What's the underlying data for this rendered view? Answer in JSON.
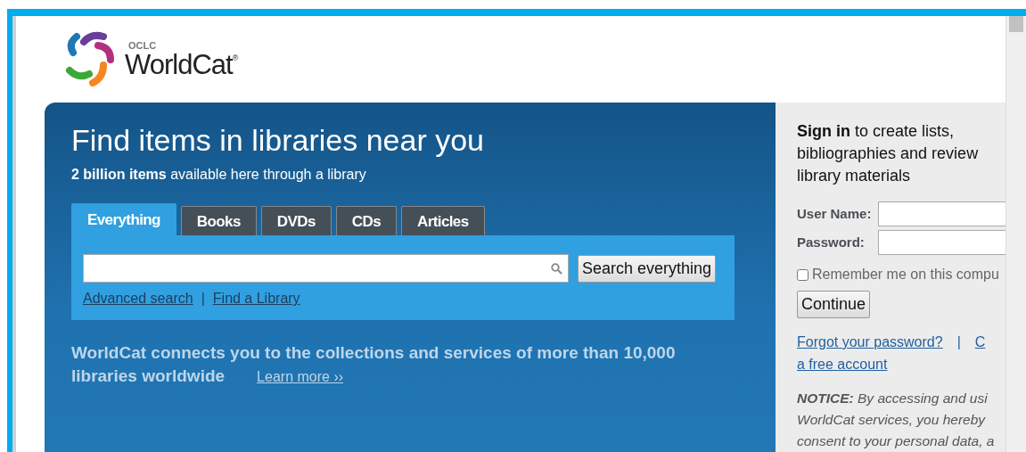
{
  "logo": {
    "overline": "OCLC",
    "name": "WorldCat$^{®}$"
  },
  "hero": {
    "title": "Find items in libraries near you",
    "subtitle": "**2 billion items** available here through a library"
  },
  "tabs": [
    {
      "label": "Everything",
      "selected": true
    },
    {
      "label": "Books",
      "selected": false
    },
    {
      "label": "DVDs",
      "selected": false
    },
    {
      "label": "CDs",
      "selected": false
    },
    {
      "label": "Articles",
      "selected": false
    }
  ],
  "search": {
    "button": "Search everything",
    "links": [
      "Advanced search",
      "Find a Library"
    ],
    "separator": "|"
  },
  "about": {
    "lines": [
      "WorldCat connects you to the collections and services of more than 10,000",
      "libraries worldwide"
    ],
    "link": "Learn more ››"
  },
  "sign_in": {
    "intro_lines": [
      "**Sign in** to create lists,",
      "bibliographies and review",
      "library materials"
    ],
    "fields": [
      {
        "label": "User Name:"
      },
      {
        "label": "Password:"
      }
    ],
    "remember": {
      "label": "Remember me on this compu",
      "checked": false
    },
    "button": "Continue",
    "forgot_link": "Forgot your password?",
    "separator": "|",
    "create_link_parts": [
      "C",
      "a free account"
    ],
    "notice_lines": [
      "**NOTICE:** By accessing and usi",
      "WorldCat services, you hereby",
      "consent to your personal data, a"
    ]
  }
}
